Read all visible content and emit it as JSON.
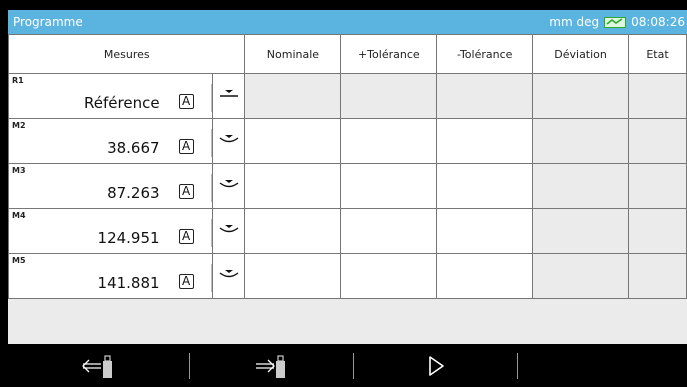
{
  "titlebar": {
    "title": "Programme",
    "units": "mm deg",
    "time": "08:08:26",
    "battery_color": "#2ea82e"
  },
  "table": {
    "headers": {
      "mesures": "Mesures",
      "nominale": "Nominale",
      "tol_plus": "+Tolérance",
      "tol_minus": "-Tolérance",
      "deviation": "Déviation",
      "etat": "Etat"
    },
    "rows": [
      {
        "label": "R1",
        "value": "Référence",
        "mode": "A"
      },
      {
        "label": "M2",
        "value": "38.667",
        "mode": "A"
      },
      {
        "label": "M3",
        "value": "87.263",
        "mode": "A"
      },
      {
        "label": "M4",
        "value": "124.951",
        "mode": "A"
      },
      {
        "label": "M5",
        "value": "141.881",
        "mode": "A"
      }
    ]
  },
  "footer": {
    "buttons": [
      {
        "icon": "usb-import-icon"
      },
      {
        "icon": "usb-export-icon"
      },
      {
        "icon": "play-icon"
      },
      {
        "icon": "empty"
      }
    ]
  }
}
